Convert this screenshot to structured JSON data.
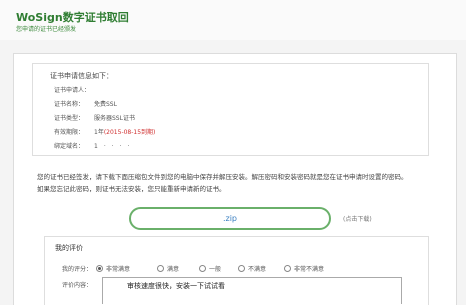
{
  "header": {
    "title": "WoSign数字证书取回",
    "subtitle": "您申请的证书已经颁发"
  },
  "info": {
    "heading": "证书申请信息如下：",
    "rows": [
      {
        "label": "证书申请人：",
        "value": ""
      },
      {
        "label": "证书名称：",
        "value": "免费SSL"
      },
      {
        "label": "证书类型：",
        "value": "服务器SSL证书"
      },
      {
        "label": "有效期限：",
        "value_prefix": "1年",
        "value_highlight": "(2015-08-15到期)"
      },
      {
        "label": "绑定域名：",
        "value": "1　·　·　·　·"
      }
    ]
  },
  "description": {
    "line1": "您的证书已经签发，请下载下面压缩包文件到您的电脑中保存并解压安装。解压密码和安装密码就是您在证书申请时设置的密码。",
    "line2": "如果您忘记此密码，则证书无法安装，您只能重新申请新的证书。"
  },
  "download": {
    "label": ".zip",
    "hint": "(点击下载)"
  },
  "evaluation": {
    "title": "我的评价",
    "rating_label": "我的评分：",
    "options": [
      "非常满意",
      "满意",
      "一般",
      "不满意",
      "非常不满意"
    ],
    "selected": "非常满意",
    "content_label": "评价内容：",
    "content_value": "审核速度很快，安装一下试试看"
  }
}
